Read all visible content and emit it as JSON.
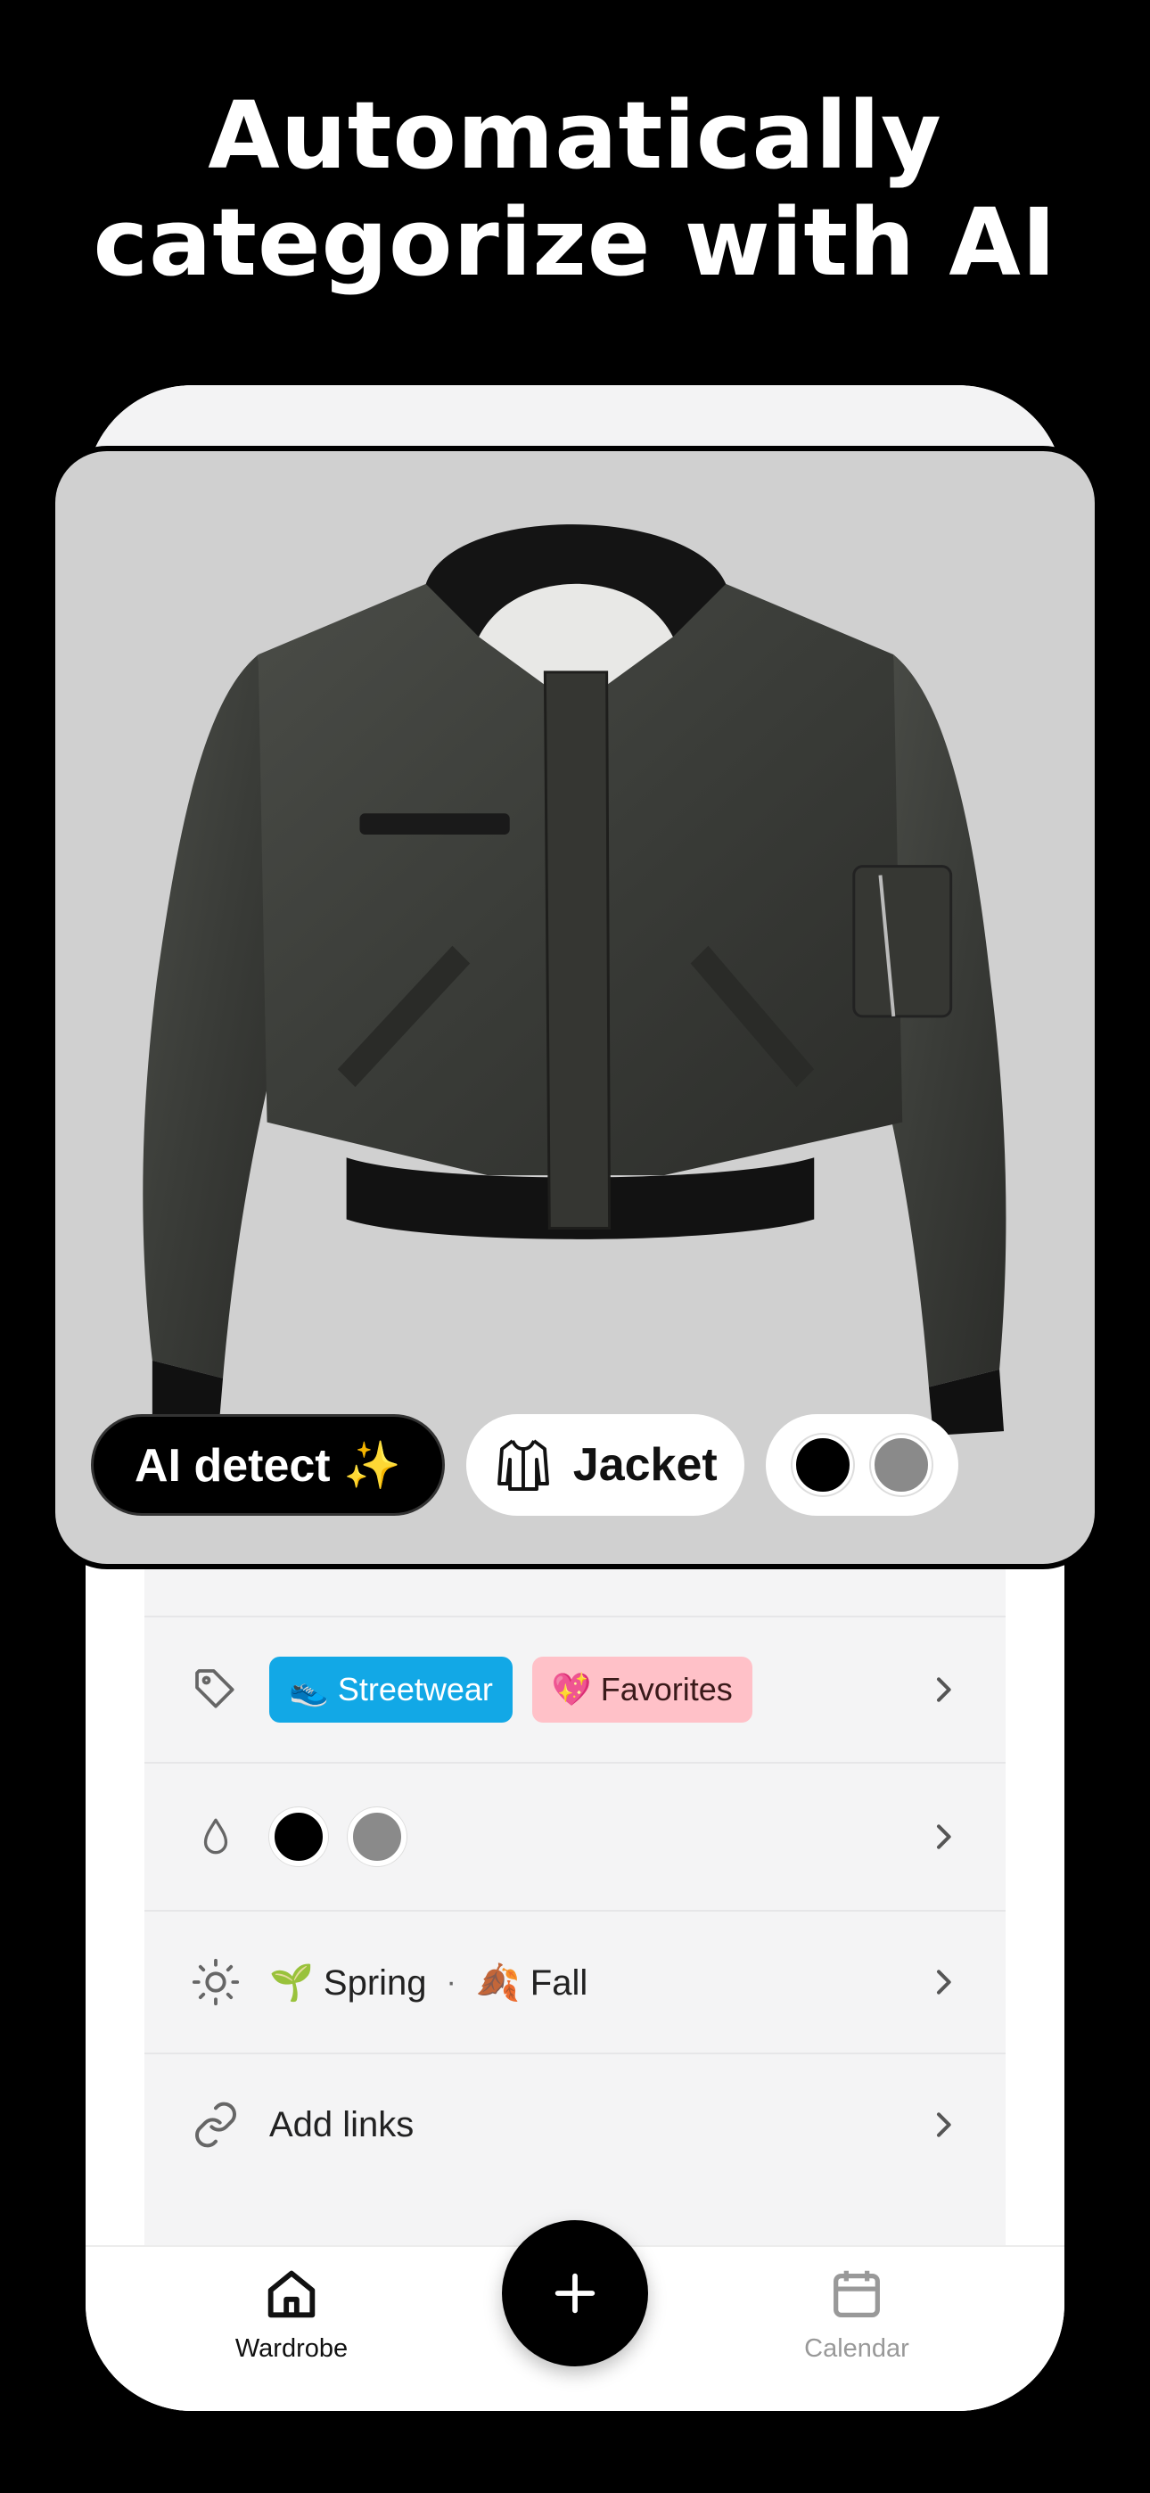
{
  "headline": {
    "line1": "Automatically",
    "line2": "categorize with AI"
  },
  "chips": {
    "ai_detect": "AI detect ✨",
    "category": "Jacket",
    "category_icon": "jacket-icon",
    "colors": [
      "#000000",
      "#8a8a8a"
    ]
  },
  "details": {
    "tags": [
      {
        "label": "👟 Streetwear",
        "color": "#12a8e6"
      },
      {
        "label": "💖 Favorites",
        "color": "#ffc1c8"
      }
    ],
    "colors": [
      "#000000",
      "#8a8a8a"
    ],
    "seasons": {
      "first": "🌱 Spring",
      "separator": "·",
      "second": "🍂 Fall"
    },
    "links_label": "Add links"
  },
  "tabbar": {
    "wardrobe": "Wardrobe",
    "calendar": "Calendar",
    "add_icon": "plus-icon"
  }
}
